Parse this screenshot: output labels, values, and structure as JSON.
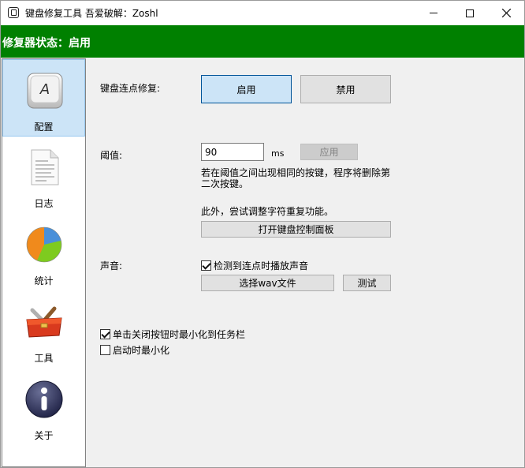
{
  "window": {
    "title": "键盘修复工具 吾爱破解：Zoshl"
  },
  "status": {
    "text": "修复器状态：启用"
  },
  "sidebar": {
    "items": [
      {
        "label": "配置",
        "icon": "keyboard-key-icon"
      },
      {
        "label": "日志",
        "icon": "document-icon"
      },
      {
        "label": "统计",
        "icon": "pie-chart-icon"
      },
      {
        "label": "工具",
        "icon": "toolbox-icon"
      },
      {
        "label": "关于",
        "icon": "info-icon"
      }
    ]
  },
  "config": {
    "fix_label": "键盘连点修复:",
    "enable_label": "启用",
    "disable_label": "禁用",
    "threshold_label": "阈值:",
    "threshold_value": "90",
    "threshold_unit": "ms",
    "apply_label": "应用",
    "desc1_line1": "若在阈值之间出现相同的按键，程序将删除第",
    "desc1_line2": "二次按键。",
    "desc2": "此外，尝试调整字符重复功能。",
    "open_panel_label": "打开键盘控制面板",
    "sound_label": "声音:",
    "sound_check_label": "检测到连点时播放声音",
    "sound_check_checked": true,
    "choose_wav_label": "选择wav文件",
    "test_label": "测试",
    "minimize_tray_label": "单击关闭按钮时最小化到任务栏",
    "minimize_tray_checked": true,
    "start_min_label": "启动时最小化",
    "start_min_checked": false
  }
}
